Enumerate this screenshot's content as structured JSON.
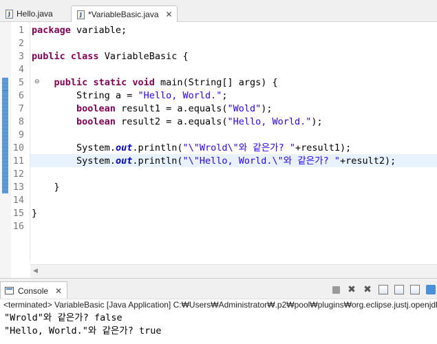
{
  "tabs": [
    {
      "label": "Hello.java",
      "icon": "java-file-icon",
      "active": false
    },
    {
      "label": "*VariableBasic.java",
      "icon": "java-file-icon",
      "active": true,
      "close": "✕"
    }
  ],
  "line_numbers": [
    "1",
    "2",
    "3",
    "4",
    "5",
    "6",
    "7",
    "8",
    "9",
    "10",
    "11",
    "12",
    "13",
    "14",
    "15",
    "16"
  ],
  "fold_marker": "⊖",
  "code": {
    "l1": {
      "kw": "package",
      "rest": " variable;"
    },
    "l3": {
      "kw1": "public",
      "kw2": "class",
      "rest": " VariableBasic {"
    },
    "l5": {
      "kw1": "public",
      "kw2": "static",
      "kw3": "void",
      "rest": " main(String[] args) {"
    },
    "l6": {
      "pre": "String a = ",
      "str": "\"Hello, World.\"",
      "post": ";"
    },
    "l7": {
      "kw": "boolean",
      "pre": " result1 = a.equals(",
      "str": "\"Wold\"",
      "post": ");"
    },
    "l8": {
      "kw": "boolean",
      "pre": " result2 = a.equals(",
      "str": "\"Hello, World.\"",
      "post": ");"
    },
    "l10": {
      "pre": "System.",
      "fld": "out",
      "mid": ".println(",
      "str": "\"\\\"Wrold\\\"와 같은가? \"",
      "post": "+result1);"
    },
    "l11": {
      "pre": "System.",
      "fld": "out",
      "mid": ".println(",
      "str": "\"\\\"Hello, World.\\\"와 같은가? \"",
      "post": "+result2);"
    },
    "l13": {
      "text": "}"
    },
    "l15": {
      "text": "}"
    }
  },
  "console": {
    "tab_label": "Console",
    "tab_close": "✕",
    "terminated": "<terminated> VariableBasic [Java Application] C:₩Users₩Administrator₩.p2₩pool₩plugins₩org.eclipse.justj.openjdk.h",
    "output": [
      "\"Wrold\"와 같은가? false",
      "\"Hello, World.\"와 같은가? true"
    ],
    "toolbar": [
      "stop-icon",
      "remove-launch-icon",
      "remove-all-terminated-icon",
      "scroll-lock-icon",
      "word-wrap-icon",
      "pin-console-icon",
      "display-console-icon"
    ]
  }
}
